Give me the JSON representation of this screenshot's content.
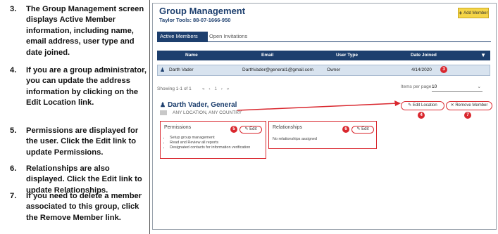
{
  "instructions": [
    {
      "number": "3.",
      "text": "The Group Management screen displays Active Member information, including name, email address, user type and date joined."
    },
    {
      "number": "4.",
      "text": "If you are a group administrator, you can update the address information by clicking on the Edit Location link."
    },
    {
      "number": "5.",
      "text": "Permissions are displayed for the user. Click the Edit link to update Permissions."
    },
    {
      "number": "6.",
      "text": "Relationships are also displayed. Click the Edit link to update Relationships."
    },
    {
      "number": "7.",
      "text": "If you need to delete a member associated to this group, click the Remove Member link."
    }
  ],
  "app": {
    "title": "Group Management",
    "subtitle": "Taylor Tools: 88-07-1666-950",
    "add_button": "Add Member"
  },
  "tabs": [
    {
      "label": "Active Members",
      "active": true
    },
    {
      "label": "Open Invitations",
      "active": false
    }
  ],
  "table": {
    "headers": [
      "Name",
      "Email",
      "User Type",
      "Date Joined"
    ],
    "rows": [
      {
        "name": "Darth Vader",
        "email": "DarthVader@general1@gmail.com",
        "user_type": "Owner",
        "date_joined": "4/14/2020"
      }
    ]
  },
  "pagination": {
    "showing": "Showing 1-1 of 1",
    "nav": "« ‹ 1 › »",
    "items_per_page_label": "Items per page",
    "items_per_page_value": "10"
  },
  "member": {
    "name": "Darth Vader, General",
    "address": "ANY LOCATION, ANY COUNTRY",
    "edit_location": "Edit Location",
    "remove_member": "Remove Member"
  },
  "permissions": {
    "title": "Permissions",
    "edit": "Edit",
    "items": [
      "Setup group management",
      "Read and Review all reports",
      "Designated contacts for information verification"
    ]
  },
  "relationships": {
    "title": "Relationships",
    "edit": "Edit",
    "text": "No relationships assigned"
  },
  "badges": [
    "3",
    "4",
    "5",
    "6",
    "7"
  ],
  "colors": {
    "primary": "#1d3f6e",
    "highlight": "#d9272e",
    "accent": "#f5d547",
    "row_bg": "#d8e3ef"
  }
}
